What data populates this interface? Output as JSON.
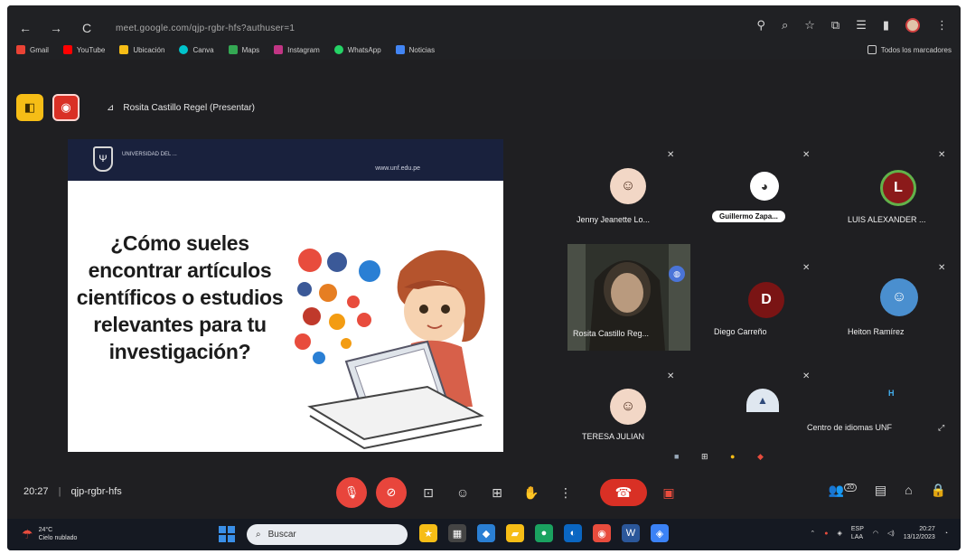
{
  "browser": {
    "nav": {
      "back": "←",
      "forward": "→",
      "reload": "C"
    },
    "url": "meet.google.com/qjp-rgbr-hfs?authuser=1",
    "bookmarks": [
      {
        "label": "Gmail",
        "color": "#ea4335"
      },
      {
        "label": "YouTube",
        "color": "#ff0000"
      },
      {
        "label": "Ubicación",
        "color": "#f6bd16"
      },
      {
        "label": "Canva",
        "color": "#00c4cc"
      },
      {
        "label": "Maps",
        "color": "#34a853"
      },
      {
        "label": "Instagram",
        "color": "#c13584"
      },
      {
        "label": "WhatsApp",
        "color": "#25d366"
      },
      {
        "label": "Noticias",
        "color": "#4285f4"
      }
    ],
    "bookmarks_right": "Todos los marcadores"
  },
  "meet": {
    "presenter": "Rosita Castillo Regel (Presentar)",
    "slide": {
      "logo_text": "UNIVERSIDAD DEL ...",
      "url": "www.unf.edu.pe",
      "question": "¿Cómo sueles encontrar artículos científicos o estudios relevantes para tu investigación?"
    },
    "participants": [
      {
        "name": "Jenny Jeanette Lo...",
        "avatar_color": "#f2d7c6"
      },
      {
        "name": "Guillermo Zapa...",
        "avatar_color": "#ffffff"
      },
      {
        "name": "LUIS ALEXANDER ...",
        "letter": "L",
        "avatar_color": "#8b1a1a"
      },
      {
        "name": "Rosita Castillo Reg...",
        "letter": ""
      },
      {
        "name": "Diego Carreño",
        "letter": "D",
        "avatar_color": "#7a1414"
      },
      {
        "name": "Heiton Ramírez",
        "avatar_color": "#4a8fcf"
      },
      {
        "name": "TERESA JULIAN",
        "avatar_color": "#f2d7c6"
      },
      {
        "name": "Centro de idiomas UNF",
        "avatar_color": "#7f6aa5"
      }
    ],
    "meeting_time": "20:27",
    "meeting_code": "qjp-rgbr-hfs",
    "participant_count": "20"
  },
  "taskbar": {
    "temperature": "24°C",
    "weather": "Cielo nublado",
    "search_placeholder": "Buscar",
    "lang": "ESP",
    "lang2": "LAA",
    "clock_time": "20:27",
    "clock_date": "13/12/2023"
  }
}
